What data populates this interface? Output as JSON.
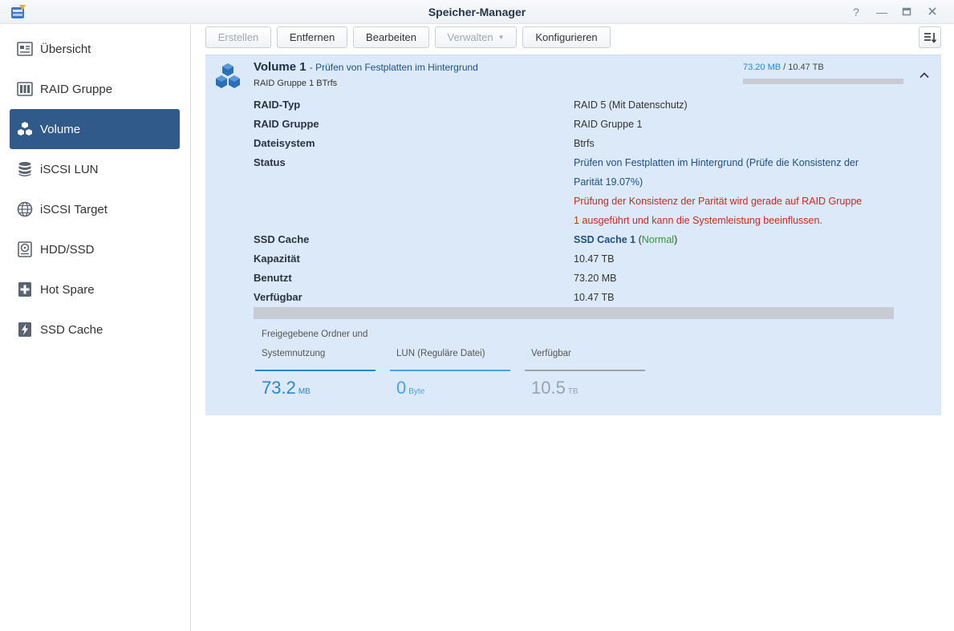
{
  "window": {
    "title": "Speicher-Manager"
  },
  "sidebar": {
    "items": [
      {
        "label": "Übersicht",
        "icon": "overview-icon"
      },
      {
        "label": "RAID Gruppe",
        "icon": "raid-icon"
      },
      {
        "label": "Volume",
        "icon": "cubes-icon",
        "active": true
      },
      {
        "label": "iSCSI LUN",
        "icon": "database-icon"
      },
      {
        "label": "iSCSI Target",
        "icon": "globe-icon"
      },
      {
        "label": "HDD/SSD",
        "icon": "hdd-icon"
      },
      {
        "label": "Hot Spare",
        "icon": "plus-box-icon"
      },
      {
        "label": "SSD Cache",
        "icon": "lightning-icon"
      }
    ]
  },
  "toolbar": {
    "create": "Erstellen",
    "remove": "Entfernen",
    "edit": "Bearbeiten",
    "manage": "Verwalten",
    "configure": "Konfigurieren"
  },
  "volume": {
    "name": "Volume 1",
    "status_short": "- Prüfen von Festplatten im Hintergrund",
    "subtitle": "RAID Gruppe 1 BTrfs",
    "used": "73.20 MB",
    "total": "/ 10.47 TB",
    "usage_fraction": 0.0
  },
  "details": {
    "raid_type_label": "RAID-Typ",
    "raid_type_value": "RAID 5 (Mit Datenschutz)",
    "raid_group_label": "RAID Gruppe",
    "raid_group_value": "RAID Gruppe 1",
    "filesystem_label": "Dateisystem",
    "filesystem_value": "Btrfs",
    "status_label": "Status",
    "status_line1": "Prüfen von Festplatten im Hintergrund (Prüfe die Konsistenz der",
    "status_line2": "Parität 19.07%)",
    "warning_line1": "Prüfung der Konsistenz der Parität wird gerade auf RAID Gruppe",
    "warning_line2": "1 ausgeführt und kann die Systemleistung beeinflussen.",
    "ssd_cache_label": "SSD Cache",
    "ssd_cache_link": "SSD Cache 1",
    "ssd_cache_open": "(",
    "ssd_cache_state": "Normal",
    "ssd_cache_close": ")",
    "capacity_label": "Kapazität",
    "capacity_value": "10.47 TB",
    "used_label": "Benutzt",
    "used_value": "73.20 MB",
    "available_label": "Verfügbar",
    "available_value": "10.47 TB"
  },
  "legend": {
    "shared_title1": "Freigegebene Ordner und",
    "shared_title2": "Systemnutzung",
    "shared_value": "73.2",
    "shared_unit": "MB",
    "lun_title": "LUN (Reguläre Datei)",
    "lun_value": "0",
    "lun_unit": "Byte",
    "avail_title": "Verfügbar",
    "avail_value": "10.5",
    "avail_unit": "TB"
  },
  "colors": {
    "accent": "#2f5a8a",
    "used_blue": "#2b86cf",
    "lun_blue": "#4aa3e0",
    "available_gray": "#9aa3ad",
    "warning_red": "#cc2a1f",
    "normal_green": "#2e9a2e",
    "panel_bg": "#dbe9f8"
  }
}
